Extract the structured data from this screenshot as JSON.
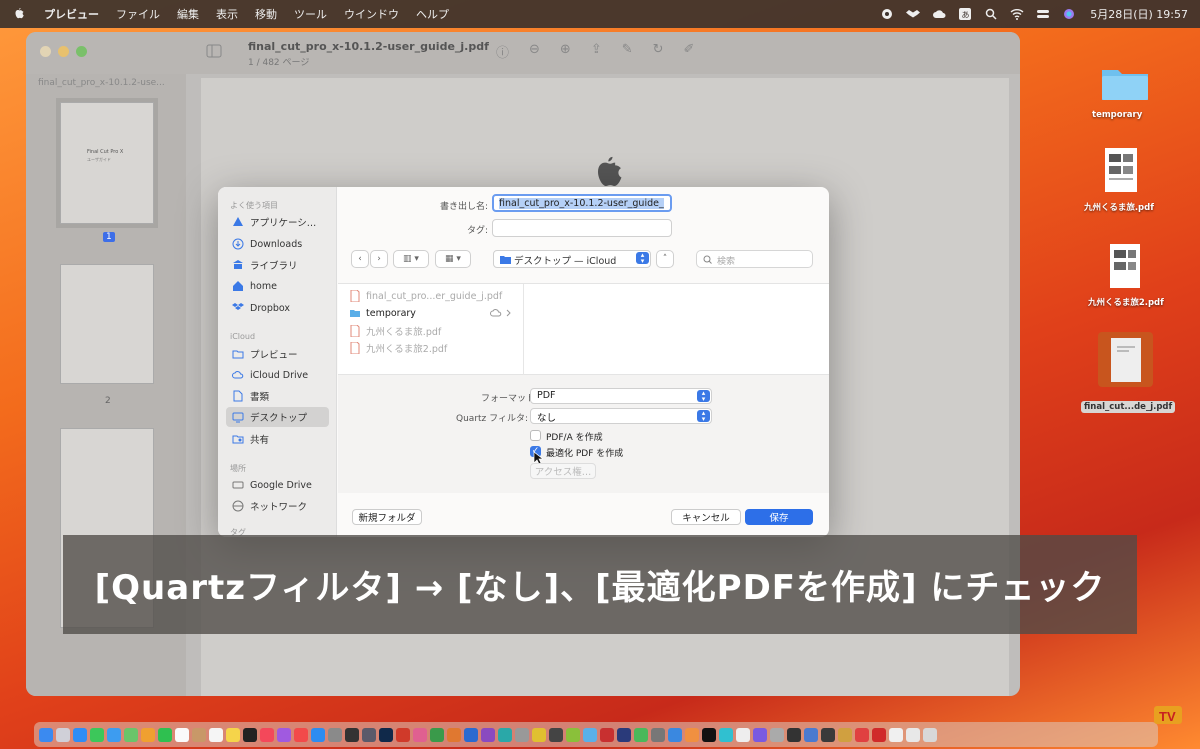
{
  "menubar": {
    "app_name": "プレビュー",
    "menus": [
      "ファイル",
      "編集",
      "表示",
      "移動",
      "ツール",
      "ウインドウ",
      "ヘルプ"
    ],
    "clock": "5月28日(日) 19:57"
  },
  "preview_window": {
    "title": "final_cut_pro_x-10.1.2-user_guide_j.pdf",
    "subtitle": "1 / 482 ページ",
    "sidebar_label": "final_cut_pro_x-10.1.2-use...",
    "thumb_cover_title": "Final Cut Pro X",
    "thumb_cover_sub": "ユーザガイド",
    "pages": [
      "1",
      "2"
    ]
  },
  "dialog": {
    "sidebar": {
      "favorites_label": "よく使う項目",
      "favorites": [
        "アプリケーシ…",
        "Downloads",
        "ライブラリ",
        "home",
        "Dropbox"
      ],
      "icloud_label": "iCloud",
      "icloud": [
        "プレビュー",
        "iCloud Drive",
        "書類",
        "デスクトップ",
        "共有"
      ],
      "locations_label": "場所",
      "locations": [
        "Google Drive",
        "ネットワーク"
      ],
      "tags_label": "タグ"
    },
    "export_as_label": "書き出し名:",
    "export_as_value": "final_cut_pro_x-10.1.2-user_guide_",
    "tags_label": "タグ:",
    "location": "デスクトップ — iCloud",
    "search_placeholder": "検索",
    "files": [
      {
        "name": "final_cut_pro...er_guide_j.pdf"
      },
      {
        "name": "temporary"
      },
      {
        "name": "九州くるま旅.pdf"
      },
      {
        "name": "九州くるま旅2.pdf"
      }
    ],
    "format_label": "フォーマット:",
    "format_value": "PDF",
    "quartz_label": "Quartz フィルタ:",
    "quartz_value": "なし",
    "pdfa_label": "PDF/A を作成",
    "pdfa_checked": false,
    "optimize_label": "最適化 PDF を作成",
    "optimize_checked": true,
    "access_label": "アクセス権…",
    "new_folder": "新規フォルダ",
    "cancel": "キャンセル",
    "save": "保存"
  },
  "desktop": {
    "icons": [
      "temporary",
      "九州くるま旅.pdf",
      "九州くるま旅2.pdf",
      "final_cut...de_j.pdf"
    ]
  },
  "caption": "[Quartzフィルタ] → [なし]、[最適化PDFを作成] にチェック",
  "colors": {
    "accent": "#2d6fe8",
    "wallpaper": "#f36b1c"
  }
}
